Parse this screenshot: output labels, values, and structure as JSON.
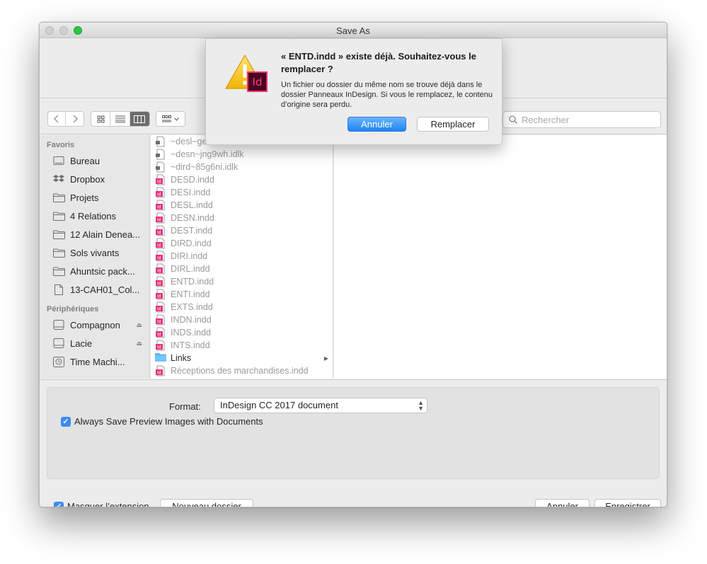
{
  "window": {
    "title": "Save As"
  },
  "alert": {
    "heading": "« ENTD.indd » existe déjà. Souhaitez-vous le remplacer ?",
    "message": "Un fichier ou dossier du même nom se trouve déjà dans le dossier Panneaux InDesign. Si vous le remplacez, le contenu d’origine sera perdu.",
    "cancel_label": "Annuler",
    "replace_label": "Remplacer",
    "app_badge": "Id"
  },
  "toolbar": {
    "search_placeholder": "Rechercher"
  },
  "sidebar": {
    "favorites_title": "Favoris",
    "favorites": [
      {
        "label": "Bureau",
        "icon": "desktop-icon"
      },
      {
        "label": "Dropbox",
        "icon": "dropbox-icon"
      },
      {
        "label": "Projets",
        "icon": "folder-icon"
      },
      {
        "label": "4 Relations",
        "icon": "folder-icon"
      },
      {
        "label": "12 Alain Deneа...",
        "icon": "folder-icon"
      },
      {
        "label": "Sols vivants",
        "icon": "folder-icon"
      },
      {
        "label": "Ahuntsic pack...",
        "icon": "folder-icon"
      },
      {
        "label": "13-CAH01_Col...",
        "icon": "document-icon"
      }
    ],
    "devices_title": "Périphériques",
    "devices": [
      {
        "label": "Compagnon",
        "icon": "drive-icon"
      },
      {
        "label": "Lacie",
        "icon": "drive-icon"
      },
      {
        "label": "Time Machi...",
        "icon": "time-machine-icon"
      }
    ]
  },
  "files": [
    {
      "name": "~desl~ge",
      "type": "lock",
      "dim": true
    },
    {
      "name": "~desn~jng9wh.idlk",
      "type": "lock",
      "dim": true
    },
    {
      "name": "~dird~85g6ni.idlk",
      "type": "lock",
      "dim": true
    },
    {
      "name": "DESD.indd",
      "type": "indd",
      "dim": true
    },
    {
      "name": "DESI.indd",
      "type": "indd",
      "dim": true
    },
    {
      "name": "DESL.indd",
      "type": "indd",
      "dim": true
    },
    {
      "name": "DESN.indd",
      "type": "indd",
      "dim": true
    },
    {
      "name": "DEST.indd",
      "type": "indd",
      "dim": true
    },
    {
      "name": "DIRD.indd",
      "type": "indd",
      "dim": true
    },
    {
      "name": "DIRI.indd",
      "type": "indd",
      "dim": true
    },
    {
      "name": "DIRL.indd",
      "type": "indd",
      "dim": true
    },
    {
      "name": "ENTD.indd",
      "type": "indd",
      "dim": true
    },
    {
      "name": "ENTI.indd",
      "type": "indd",
      "dim": true
    },
    {
      "name": "EXTS.indd",
      "type": "indd",
      "dim": true
    },
    {
      "name": "INDN.indd",
      "type": "indd",
      "dim": true
    },
    {
      "name": "INDS.indd",
      "type": "indd",
      "dim": true
    },
    {
      "name": "INTS.indd",
      "type": "indd",
      "dim": true
    },
    {
      "name": "Links",
      "type": "folder",
      "dim": false
    },
    {
      "name": "Réceptions des marchandises.indd",
      "type": "indd",
      "dim": true
    }
  ],
  "options": {
    "format_label": "Format:",
    "format_value": "InDesign CC 2017 document",
    "preview_label": "Always Save Preview Images with Documents",
    "preview_checked": true
  },
  "footer": {
    "hide_extension_label": "Masquer l’extension",
    "hide_extension_checked": true,
    "new_folder_label": "Nouveau dossier",
    "cancel_label": "Annuler",
    "save_label": "Enregistrer"
  },
  "colors": {
    "accent": "#1b86f3",
    "indesign": "#e8317b"
  }
}
